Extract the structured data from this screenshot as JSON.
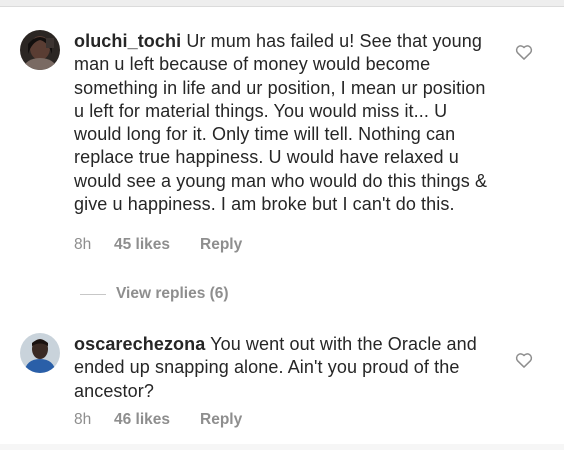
{
  "comments": [
    {
      "username": "oluchi_tochi",
      "text": "Ur mum has failed u! See that young man u left because of money would become something in life and ur position, I mean ur position u left for material things. You would miss it... U would long for it. Only time will tell. Nothing can replace true happiness. U would have relaxed u would see a young man who would do this things & give u happiness. I am broke but I can't do this.",
      "time": "8h",
      "likes": "45 likes",
      "reply": "Reply",
      "view_replies": "View replies (6)"
    },
    {
      "username": "oscarechezona",
      "text": "You went out with the Oracle and ended up snapping alone. Ain't you proud of the ancestor?",
      "time": "8h",
      "likes": "46 likes",
      "reply": "Reply"
    }
  ],
  "icons": {
    "like": "heart-outline-icon"
  },
  "colors": {
    "text": "#262626",
    "secondary": "#8e8e8e"
  }
}
